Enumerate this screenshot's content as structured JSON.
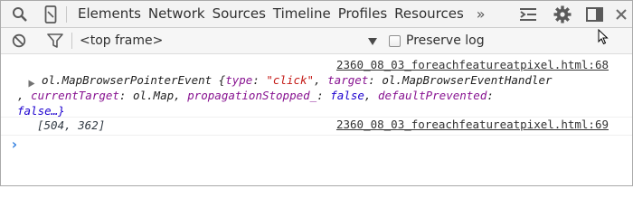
{
  "toolbar": {
    "tabs": [
      "Elements",
      "Network",
      "Sources",
      "Timeline",
      "Profiles",
      "Resources"
    ],
    "overflow": "»"
  },
  "console_bar": {
    "frame": "<top frame>",
    "preserve_log": "Preserve log"
  },
  "messages": [
    {
      "source": "2360_08_03_foreachfeatureatpixel.html:68",
      "type": "ol.MapBrowserPointerEvent",
      "open_brace": " {",
      "p1_key": "type",
      "p1_val": "\"click\"",
      "p2_key": "target",
      "p2_val": "ol.MapBrowserEventHandler",
      "p3_key": "currentTarget",
      "p3_val": "ol.Map",
      "p4_key": "propagationStopped_",
      "p4_val": "false",
      "p5_key": "defaultPrevented",
      "p5_val": "false…}"
    },
    {
      "source": "2360_08_03_foreachfeatureatpixel.html:69",
      "text": "[504, 362]"
    }
  ],
  "prompt": "›"
}
